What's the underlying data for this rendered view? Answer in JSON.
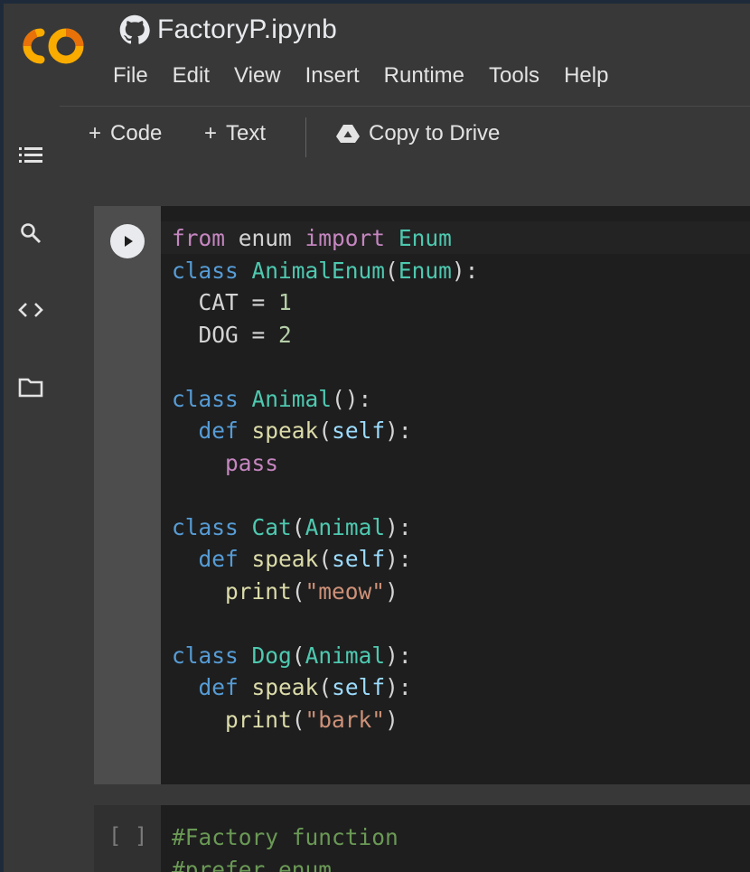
{
  "app": {
    "notebook_title": "FactoryP.ipynb",
    "logo_text": "CO",
    "colors": {
      "accent_orange": "#f9ab00",
      "accent_dark_orange": "#e8710a"
    }
  },
  "menu": [
    "File",
    "Edit",
    "View",
    "Insert",
    "Runtime",
    "Tools",
    "Help"
  ],
  "toolbar": {
    "add_code_label": "Code",
    "add_text_label": "Text",
    "copy_to_drive_label": "Copy to Drive"
  },
  "sidebar": {
    "icons": [
      "table-of-contents-icon",
      "search-icon",
      "code-snippets-icon",
      "files-icon"
    ]
  },
  "cells": [
    {
      "type": "code",
      "run_state": "run-button",
      "lines": [
        "from enum import Enum",
        "class AnimalEnum(Enum):",
        "  CAT = 1",
        "  DOG = 2",
        "",
        "class Animal():",
        "  def speak(self):",
        "    pass",
        "",
        "class Cat(Animal):",
        "  def speak(self):",
        "    print(\"meow\")",
        "",
        "class Dog(Animal):",
        "  def speak(self):",
        "    print(\"bark\")"
      ]
    },
    {
      "type": "code",
      "exec_marker": "[ ]",
      "lines": [
        "#Factory function",
        "#prefer enum"
      ]
    }
  ]
}
